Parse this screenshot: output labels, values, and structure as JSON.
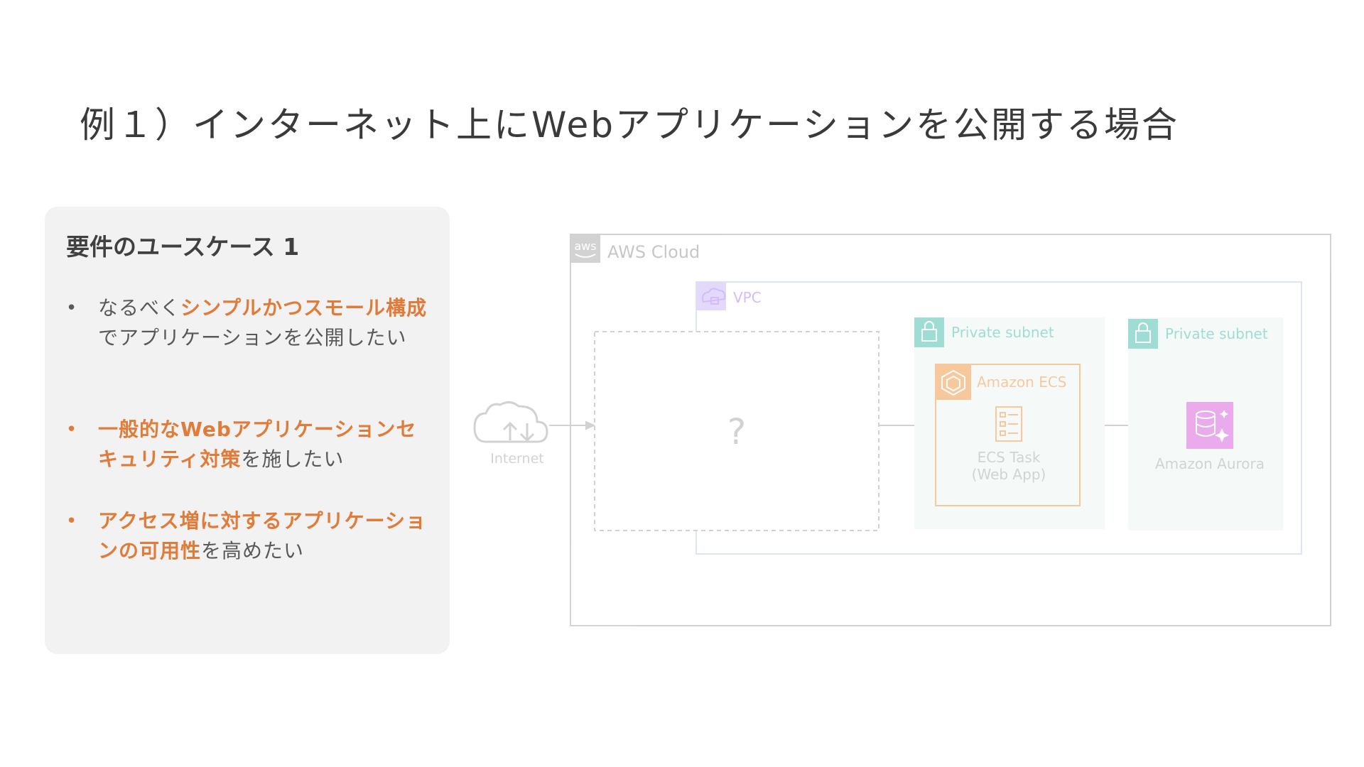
{
  "title": "例１）インターネット上にWebアプリケーションを公開する場合",
  "panel": {
    "heading": "要件のユースケース 1",
    "requirements": [
      {
        "parts": [
          {
            "text": "なるべく",
            "hl": false
          },
          {
            "text": "シンプルかつスモール構成",
            "hl": true
          },
          {
            "text": "でアプリケーションを公開したい",
            "hl": false
          }
        ]
      },
      {
        "parts": [
          {
            "text": "一般的なWebアプリケーションセキュリティ対策",
            "hl": true
          },
          {
            "text": "を施したい",
            "hl": false
          }
        ]
      },
      {
        "parts": [
          {
            "text": "アクセス増に対するアプリケーションの可用性",
            "hl": true
          },
          {
            "text": "を高めたい",
            "hl": false
          }
        ]
      }
    ]
  },
  "diagram": {
    "aws_cloud_label": "AWS Cloud",
    "aws_logo_text": "aws",
    "vpc_label": "VPC",
    "internet_label": "Internet",
    "unknown_marker": "?",
    "subnet1_label": "Private subnet",
    "subnet2_label": "Private subnet",
    "ecs_label": "Amazon ECS",
    "task_label_line1": "ECS Task",
    "task_label_line2": "(Web App)",
    "aurora_label": "Amazon Aurora"
  },
  "colors": {
    "highlight": "#e07b39",
    "body_text": "#595959",
    "panel_bg": "#f2f2f2",
    "aws_gray": "#8c8c8c",
    "vpc_purple": "#8c4fff",
    "subnet_teal": "#01a88d",
    "ecs_orange": "#ed7100",
    "aurora_pink": "#c925d1"
  }
}
